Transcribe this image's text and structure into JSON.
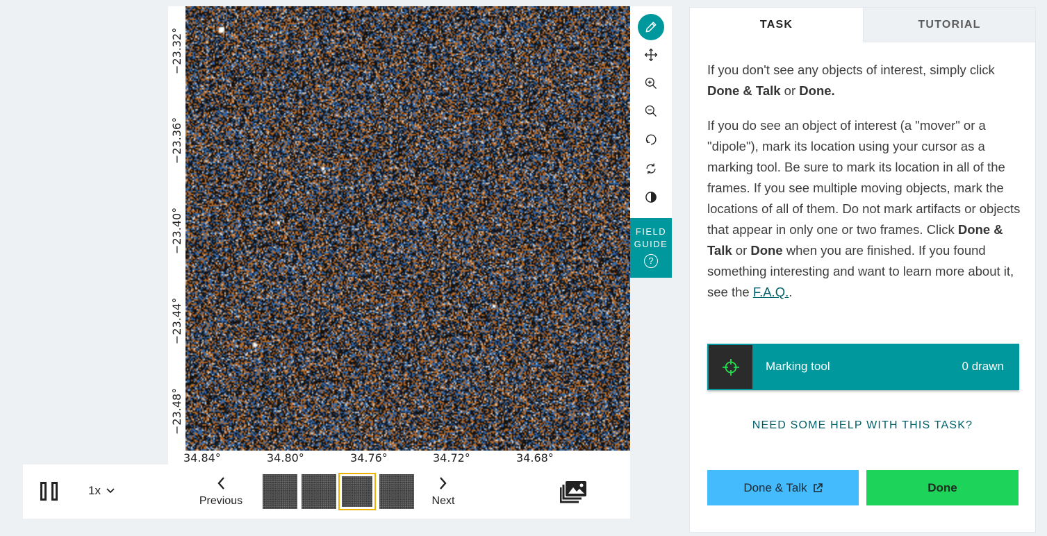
{
  "viewer": {
    "dec_ticks": [
      "−23.32°",
      "−23.36°",
      "−23.40°",
      "−23.44°",
      "−23.48°"
    ],
    "ra_ticks": [
      "34.84°",
      "34.80°",
      "34.76°",
      "34.72°",
      "34.68°"
    ],
    "colors": {
      "orange": "#b86a28",
      "blue": "#2f66a8",
      "white": "#dcdcdc",
      "black": "#101010"
    }
  },
  "toolbar": {
    "tools": [
      {
        "name": "annotate",
        "icon": "pencil-icon",
        "active": true
      },
      {
        "name": "move",
        "icon": "move-arrows-icon"
      },
      {
        "name": "zoom_in",
        "icon": "zoom-in-icon"
      },
      {
        "name": "zoom_out",
        "icon": "zoom-out-icon"
      },
      {
        "name": "rotate",
        "icon": "rotate-icon"
      },
      {
        "name": "reset",
        "icon": "reset-icon"
      },
      {
        "name": "invert",
        "icon": "contrast-icon"
      }
    ],
    "field_guide_line1": "FIELD",
    "field_guide_line2": "GUIDE",
    "field_guide_help": "?"
  },
  "controls": {
    "speed": "1x",
    "previous_label": "Previous",
    "next_label": "Next",
    "frame_count": 4,
    "active_frame": 3
  },
  "task_panel": {
    "tabs": {
      "task": "TASK",
      "tutorial": "TUTORIAL"
    },
    "p1": {
      "a": "If you don't see any objects of interest, simply click ",
      "b1": "Done & Talk",
      "c": " or ",
      "b2": "Done."
    },
    "p2": {
      "a": "If you do see an object of interest (a \"mover\" or a \"dipole\"), mark its location using your cursor as a marking tool. Be sure to mark its location in all of the frames. If you see multiple moving objects, mark the locations of all of them. Do not mark artifacts or objects that appear in only one or two frames. Click ",
      "b1": "Done & Talk",
      "c": " or ",
      "b2": "Done",
      "d": " when you are finished. If you found something interesting and want to learn more about it, see the ",
      "link": "F.A.Q.",
      "e": "."
    },
    "marking_tool": {
      "label": "Marking tool",
      "count": "0 drawn",
      "crosshair_color": "#22e04a"
    },
    "help_link": "NEED SOME HELP WITH THIS TASK?",
    "done_talk_label": "Done & Talk",
    "done_label": "Done",
    "colors": {
      "accent": "#00979d",
      "done_talk": "#43bbfd",
      "done": "#1ed359"
    }
  }
}
